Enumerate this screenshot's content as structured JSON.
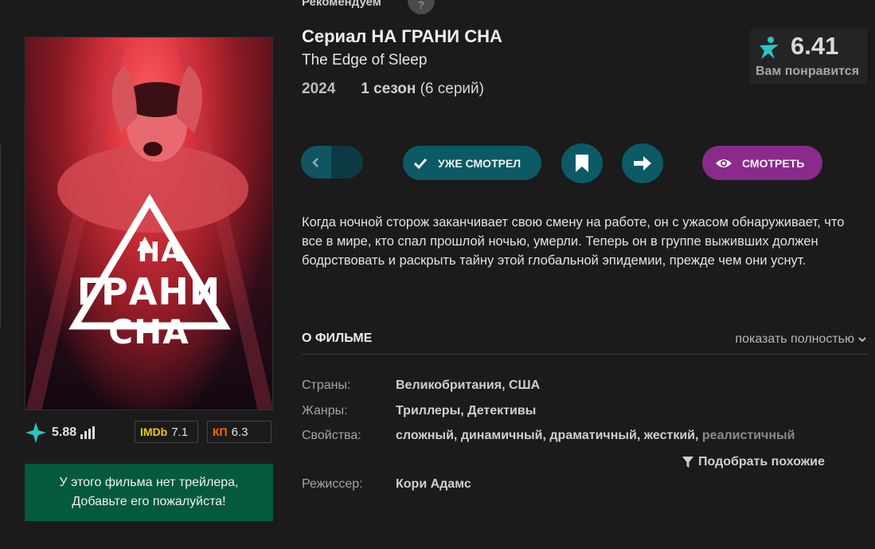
{
  "recommend": {
    "label": "Рекомендуем",
    "help": "?"
  },
  "poster": {
    "title_lines": [
      "НА",
      "ГРАНИ",
      "СНА"
    ]
  },
  "ratings": {
    "own": "5.88",
    "imdb_brand": "IMDb",
    "imdb_value": "7.1",
    "kp_brand": "КП",
    "kp_value": "6.3"
  },
  "trailer": {
    "line1": "У этого фильма нет трейлера,",
    "line2": "Добавьте его пожалуйста!"
  },
  "header": {
    "title": "Сериал НА ГРАНИ СНА",
    "original_title": "The Edge of Sleep",
    "year": "2024",
    "season_bold": "1 сезон",
    "season_rest": " (6 серий)"
  },
  "score": {
    "value": "6.41",
    "caption": "Вам понравится"
  },
  "actions": {
    "watched_label": "УЖЕ СМОТРЕЛ",
    "watch_label": "СМОТРЕТЬ"
  },
  "description": "Когда ночной сторож заканчивает свою смену на работе, он с ужасом обнаруживает, что все в мире, кто спал прошлой ночью, умерли. Теперь он в группе выживших должен бодрствовать и раскрыть тайну этой глобальной эпидемии, прежде чем они уснут.",
  "about": {
    "title": "О ФИЛЬМЕ",
    "show_full": "показать полностью",
    "countries_label": "Страны:",
    "countries": [
      "Великобритания",
      "США"
    ],
    "genres_label": "Жанры:",
    "genres": [
      "Триллеры",
      "Детективы"
    ],
    "props_label": "Свойства:",
    "props": [
      "сложный",
      "динамичный",
      "драматичный",
      "жесткий",
      "реалистичный"
    ],
    "similar": "Подобрать похожие",
    "director_label": "Режиссер:",
    "director": "Кори Адамс"
  },
  "colors": {
    "background": "#1b1b1b",
    "teal_button": "#0c5a66",
    "watch_button": "#8a2a8c",
    "trailer_box": "#05593f",
    "star_accent": "#2ec4c4"
  },
  "icons": [
    "help-icon",
    "star-icon",
    "bars-icon",
    "chevron-left-icon",
    "check-icon",
    "bookmark-icon",
    "arrow-right-icon",
    "eye-icon",
    "chevron-down-icon",
    "filter-icon"
  ]
}
